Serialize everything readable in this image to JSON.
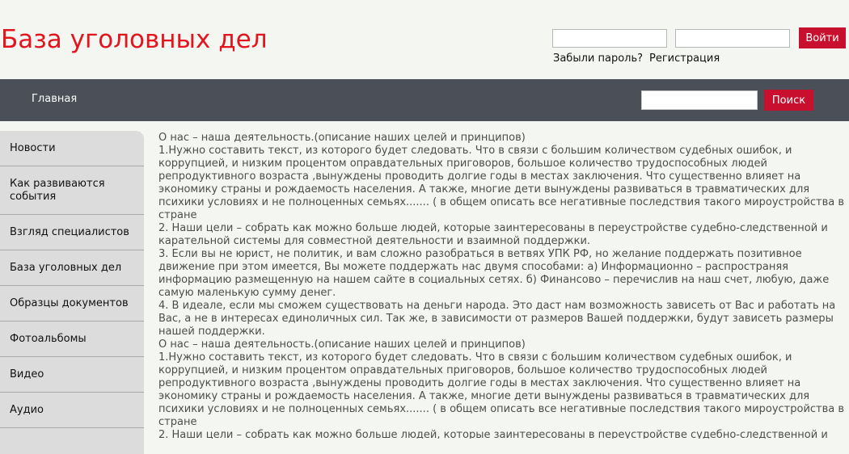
{
  "header": {
    "title": "База уголовных дел",
    "login_button": "Войти",
    "forgot_password": "Забыли пароль?",
    "register": "Регистрация"
  },
  "nav": {
    "home": "Главная",
    "search_button": "Поиск"
  },
  "sidebar": {
    "items": [
      {
        "label": "Новости"
      },
      {
        "label": "Как развиваются события"
      },
      {
        "label": "Взгляд специалистов"
      },
      {
        "label": "База уголовных дел"
      },
      {
        "label": "Образцы документов"
      },
      {
        "label": "Фотоальбомы"
      },
      {
        "label": "Видео"
      },
      {
        "label": "Аудио"
      }
    ]
  },
  "content": {
    "paragraphs": [
      "О нас – наша деятельность.(описание наших целей и принципов)",
      "1.Нужно составить текст, из которого будет следовать. Что в связи с большим количеством судебных ошибок, и коррупцией, и низким процентом оправдательных приговоров, большое количество трудоспособных людей репродуктивного возраста ,вынуждены проводить долгие годы в местах заключения. Что существенно влияет на экономику страны и рождаемость населения. А также, многие дети вынуждены развиваться в травматических для психики условиях и не полноценных семьях....... ( в общем описать все негативные последствия такого мироустройства в стране",
      "2. Наши цели – собрать как можно больше людей, которые заинтересованы в переустройстве судебно-следственной и карательной системы для совместной деятельности и взаимной поддержки.",
      "3. Если вы не юрист, не политик, и вам сложно разобраться в ветвях УПК РФ, но желание поддержать позитивное движение при этом имеется, Вы можете поддержать нас двумя способами: а) Информационно – распространяя информацию размещенную на нашем сайте в социальных сетях. б) Финансово – перечислив на наш счет, любую, даже самую маленькую сумму денег.",
      "4. В идеале, если мы сможем существовать на деньги народа. Это даст нам возможность зависеть от Вас и работать на Вас, а не в интересах единоличных сил. Так же, в зависимости от размеров Вашей поддержки, будут зависеть размеры нашей поддержки.",
      "О нас – наша деятельность.(описание наших целей и принципов)",
      "1.Нужно составить текст, из которого будет следовать. Что в связи с большим количеством судебных ошибок, и коррупцией, и низким процентом оправдательных приговоров, большое количество трудоспособных людей репродуктивного возраста ,вынуждены проводить долгие годы в местах заключения. Что существенно влияет на экономику страны и рождаемость населения. А также, многие дети вынуждены развиваться в травматических для психики условиях и не полноценных семьях....... ( в общем описать все негативные последствия такого мироустройства в стране",
      "2. Наши цели – собрать как можно больше людей, которые заинтересованы в переустройстве судебно-следственной и"
    ]
  },
  "colors": {
    "title_red": "#e2151f",
    "button_red": "#c8102e",
    "nav_bg": "#4b5058",
    "page_bg": "#f4f6f1",
    "sidebar_bg": "#dcdcdc"
  }
}
